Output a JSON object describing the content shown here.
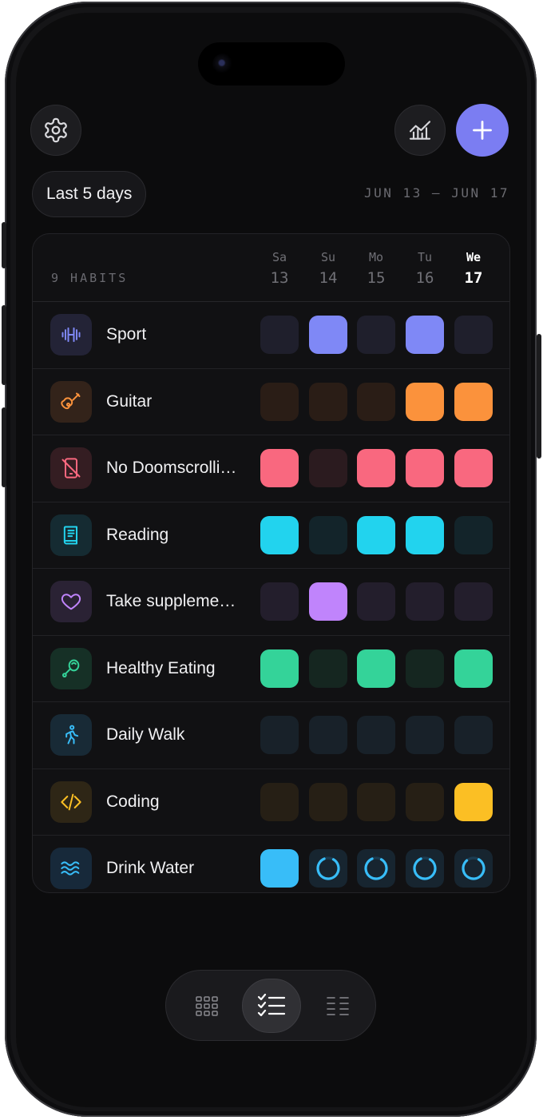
{
  "header": {
    "range_label": "Last 5 days",
    "date_range": "JUN 13 — JUN 17"
  },
  "colors": {
    "accent": "#7b7df2",
    "background": "#0c0c0d"
  },
  "table": {
    "habit_count": "9 HABITS",
    "days": [
      {
        "name": "Sa",
        "date": "13",
        "today": false
      },
      {
        "name": "Su",
        "date": "14",
        "today": false
      },
      {
        "name": "Mo",
        "date": "15",
        "today": false
      },
      {
        "name": "Tu",
        "date": "16",
        "today": false
      },
      {
        "name": "We",
        "date": "17",
        "today": true
      }
    ]
  },
  "habits": [
    {
      "name": "Sport",
      "icon": "dumbbell-icon",
      "color": "#7f88f6",
      "dim": "#1f1f2c",
      "iconbg": "#232336",
      "done": [
        false,
        true,
        false,
        true,
        false
      ]
    },
    {
      "name": "Guitar",
      "icon": "guitar-icon",
      "color": "#fb923c",
      "dim": "#2a1d16",
      "iconbg": "#33231a",
      "done": [
        false,
        false,
        false,
        true,
        true
      ]
    },
    {
      "name": "No Doomscrolli…",
      "icon": "phone-off-icon",
      "color": "#f9687f",
      "dim": "#2b1b1f",
      "iconbg": "#341d22",
      "done": [
        true,
        false,
        true,
        true,
        true
      ]
    },
    {
      "name": "Reading",
      "icon": "book-icon",
      "color": "#22d3ee",
      "dim": "#13242a",
      "iconbg": "#152b32",
      "done": [
        true,
        false,
        true,
        true,
        false
      ]
    },
    {
      "name": "Take suppleme…",
      "icon": "heart-icon",
      "color": "#c084fc",
      "dim": "#231e2c",
      "iconbg": "#2a2234",
      "done": [
        false,
        true,
        false,
        false,
        false
      ]
    },
    {
      "name": "Healthy Eating",
      "icon": "food-icon",
      "color": "#34d399",
      "dim": "#152620",
      "iconbg": "#163026",
      "done": [
        true,
        false,
        true,
        false,
        true
      ]
    },
    {
      "name": "Daily Walk",
      "icon": "walking-icon",
      "color": "#38bdf8",
      "dim": "#182129",
      "iconbg": "#182a36",
      "done": [
        false,
        false,
        false,
        false,
        false
      ]
    },
    {
      "name": "Coding",
      "icon": "code-icon",
      "color": "#fbbf24",
      "dim": "#261f15",
      "iconbg": "#2e2616",
      "done": [
        false,
        false,
        false,
        false,
        true
      ]
    },
    {
      "name": "Drink Water",
      "icon": "waves-icon",
      "color": "#38bdf8",
      "dim": "#172530",
      "iconbg": "#17293a",
      "done": [
        true,
        false,
        false,
        false,
        false
      ],
      "progress": [
        1,
        0.85,
        0.85,
        0.85,
        0.8
      ]
    }
  ],
  "nav": {
    "items": [
      {
        "icon": "grid-icon",
        "active": false
      },
      {
        "icon": "checklist-icon",
        "active": true
      },
      {
        "icon": "list-icon",
        "active": false
      }
    ]
  }
}
